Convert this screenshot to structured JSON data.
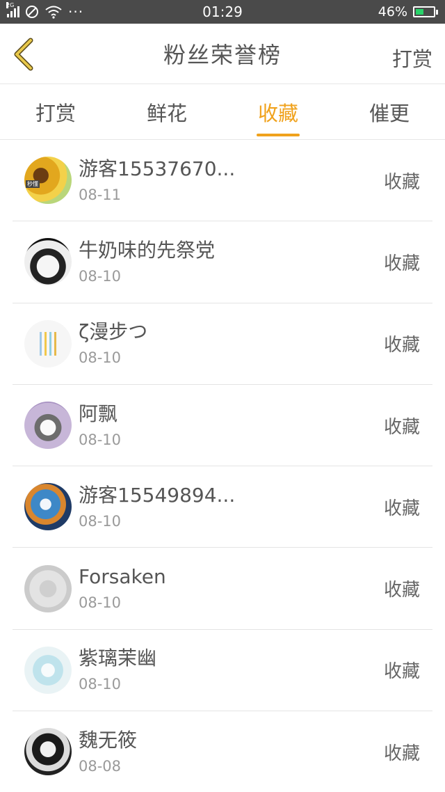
{
  "status_bar": {
    "network": "2G",
    "time": "01:29",
    "battery": "46%",
    "battery_level": 0.46,
    "icons": [
      "signal-icon",
      "no-disturb-icon",
      "wifi-icon",
      "more-dots-icon",
      "battery-icon"
    ]
  },
  "header": {
    "back_icon": "chevron-left-icon",
    "back_color": "#e8c84a",
    "title": "粉丝荣誉榜",
    "right_action": "打赏"
  },
  "tabs": [
    {
      "label": "打赏",
      "active": false
    },
    {
      "label": "鲜花",
      "active": false
    },
    {
      "label": "收藏",
      "active": true
    },
    {
      "label": "催更",
      "active": false
    }
  ],
  "accent_color": "#f0a21c",
  "list": [
    {
      "name": "游客15537670...",
      "date": "08-11",
      "action": "收藏",
      "avatar": "sunflower-avatar",
      "avatar_label": "秒懂"
    },
    {
      "name": "牛奶味的先祭党",
      "date": "08-10",
      "action": "收藏",
      "avatar": "anime-avatar"
    },
    {
      "name": "ζ漫步つ",
      "date": "08-10",
      "action": "收藏",
      "avatar": "pencils-avatar"
    },
    {
      "name": "阿飘",
      "date": "08-10",
      "action": "收藏",
      "avatar": "husky-avatar"
    },
    {
      "name": "游客15549894...",
      "date": "08-10",
      "action": "收藏",
      "avatar": "blue-anime-avatar"
    },
    {
      "name": "Forsaken",
      "date": "08-10",
      "action": "收藏",
      "avatar": "gray-avatar"
    },
    {
      "name": "紫璃茉幽",
      "date": "08-10",
      "action": "收藏",
      "avatar": "mint-anime-avatar"
    },
    {
      "name": "魏无筱",
      "date": "08-08",
      "action": "收藏",
      "avatar": "dark-anime-avatar"
    }
  ]
}
